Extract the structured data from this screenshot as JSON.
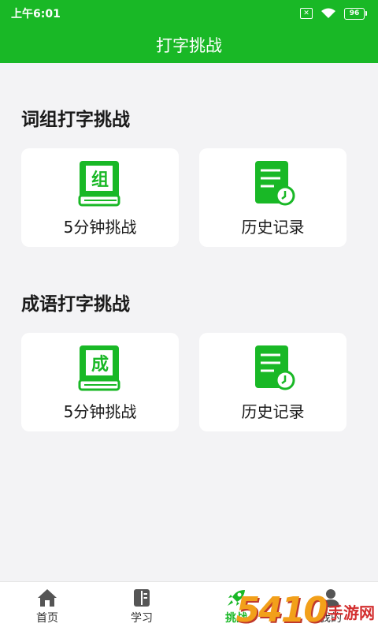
{
  "status": {
    "time": "上午6:01",
    "battery": "96"
  },
  "header": {
    "title": "打字挑战"
  },
  "sections": [
    {
      "title": "词组打字挑战",
      "cards": [
        {
          "label": "5分钟挑战",
          "icon": "book-icon",
          "book_char": "组"
        },
        {
          "label": "历史记录",
          "icon": "history-icon"
        }
      ]
    },
    {
      "title": "成语打字挑战",
      "cards": [
        {
          "label": "5分钟挑战",
          "icon": "book-icon",
          "book_char": "成"
        },
        {
          "label": "历史记录",
          "icon": "history-icon"
        }
      ]
    }
  ],
  "tabs": [
    {
      "label": "首页",
      "icon": "home-icon"
    },
    {
      "label": "学习",
      "icon": "book-open-icon"
    },
    {
      "label": "挑战",
      "icon": "rocket-icon",
      "active": true
    },
    {
      "label": "我的",
      "icon": "user-icon"
    }
  ],
  "watermark": {
    "number": "5410",
    "text": "手游网"
  },
  "colors": {
    "brand": "#19b826",
    "background": "#f3f3f5"
  }
}
